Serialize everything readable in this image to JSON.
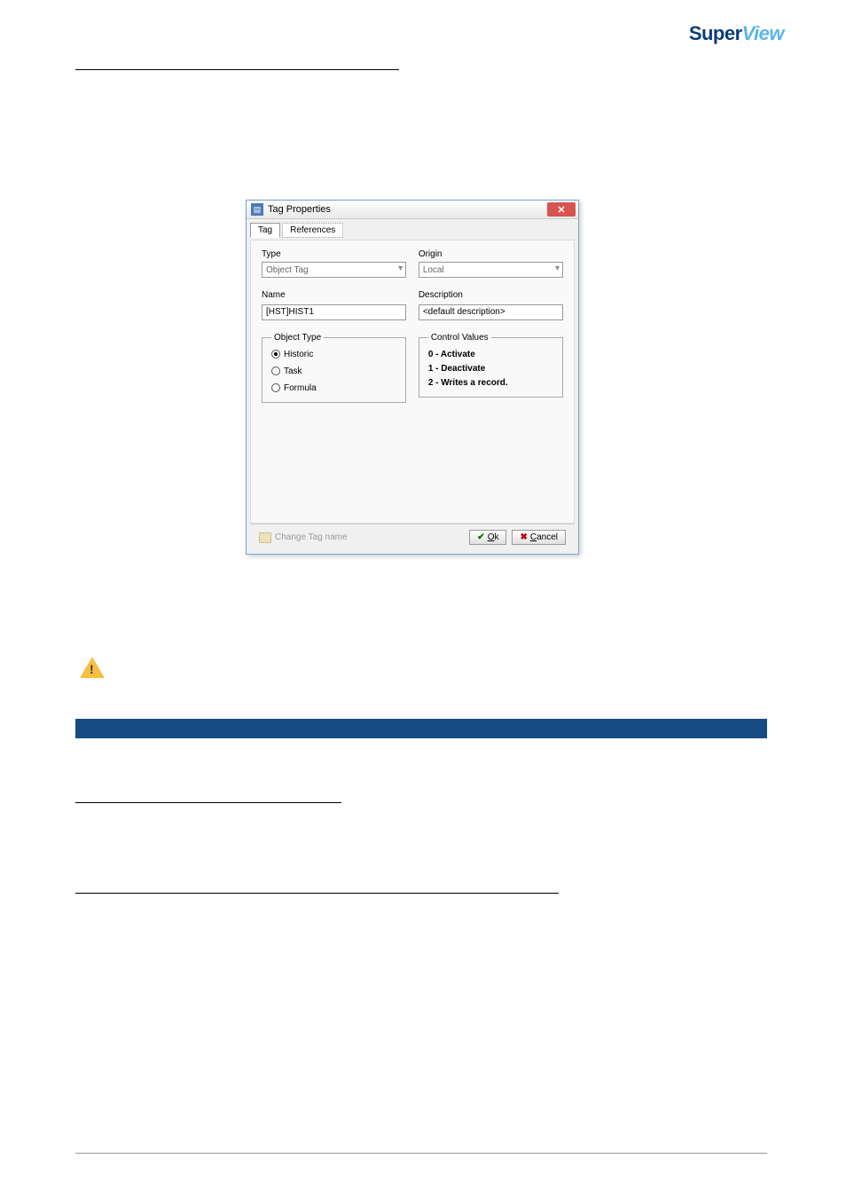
{
  "logo": {
    "main": "Super",
    "accent": "View"
  },
  "dialog": {
    "title": "Tag Properties",
    "tabs": [
      "Tag",
      "References"
    ],
    "typeLabel": "Type",
    "typeValue": "Object Tag",
    "originLabel": "Origin",
    "originValue": "Local",
    "nameLabel": "Name",
    "nameValue": "[HST]HIST1",
    "descLabel": "Description",
    "descValue": "<default description>",
    "objectTypeLegend": "Object Type",
    "radios": {
      "historic": "Historic",
      "task": "Task",
      "formula": "Formula"
    },
    "controlValuesLegend": "Control Values",
    "controlValues": {
      "v0": "0 - Activate",
      "v1": "1 - Deactivate",
      "v2": "2 - Writes a record."
    },
    "changeTagName": "Change Tag name",
    "okLabel": "Ok",
    "cancelLabel": "Cancel"
  }
}
